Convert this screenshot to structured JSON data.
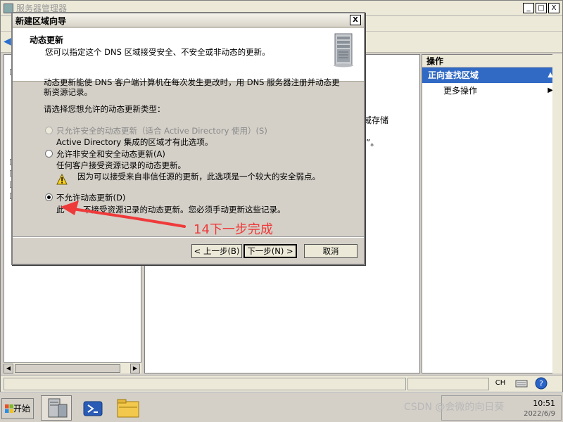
{
  "main_window": {
    "title": "服务器管理器",
    "minimize": "_",
    "maximize": "□",
    "close": "X",
    "center_fragments": [
      "域存储",
      "”。"
    ]
  },
  "actions_pane": {
    "header": "操作",
    "section_title": "正向查找区域",
    "section_collapse": "▲",
    "more_actions": "更多操作",
    "more_arrow": "▶"
  },
  "status_bar": {
    "input_lang": "CH"
  },
  "dialog": {
    "title": "新建区域向导",
    "close": "X",
    "header_title": "动态更新",
    "header_subtitle": "您可以指定这个 DNS 区域接受安全、不安全或非动态的更新。",
    "description_line1": "动态更新能使 DNS 客户端计算机在每次发生更改时，用 DNS 服务器注册并动态更",
    "description_line2": "新资源记录。",
    "prompt": "请选择您想允许的动态更新类型：",
    "options": [
      {
        "label": "只允许安全的动态更新（适合 Active Directory 使用）(S)",
        "desc": "Active Directory 集成的区域才有此选项。",
        "checked": false,
        "disabled": true
      },
      {
        "label": "允许非安全和安全动态更新(A)",
        "desc": "任何客户接受资源记录的动态更新。",
        "warning": "因为可以接受来自非信任源的更新，此选项是一个较大的安全弱点。",
        "checked": false,
        "disabled": false
      },
      {
        "label": "不允许动态更新(D)",
        "desc_part1": "此",
        "desc_part2": "不接受资源记录的动态更新。您必须手动更新这些记录。",
        "checked": true,
        "disabled": false
      }
    ],
    "buttons": {
      "back": "< 上一步(B)",
      "next": "下一步(N) >",
      "cancel": "取消"
    }
  },
  "annotation": {
    "text": "14下一步完成",
    "color": "#ef3a3a"
  },
  "taskbar": {
    "start_label": "开始",
    "time": "10:51",
    "date": "2022/6/9",
    "watermark": "CSDN @会微的向日葵"
  }
}
